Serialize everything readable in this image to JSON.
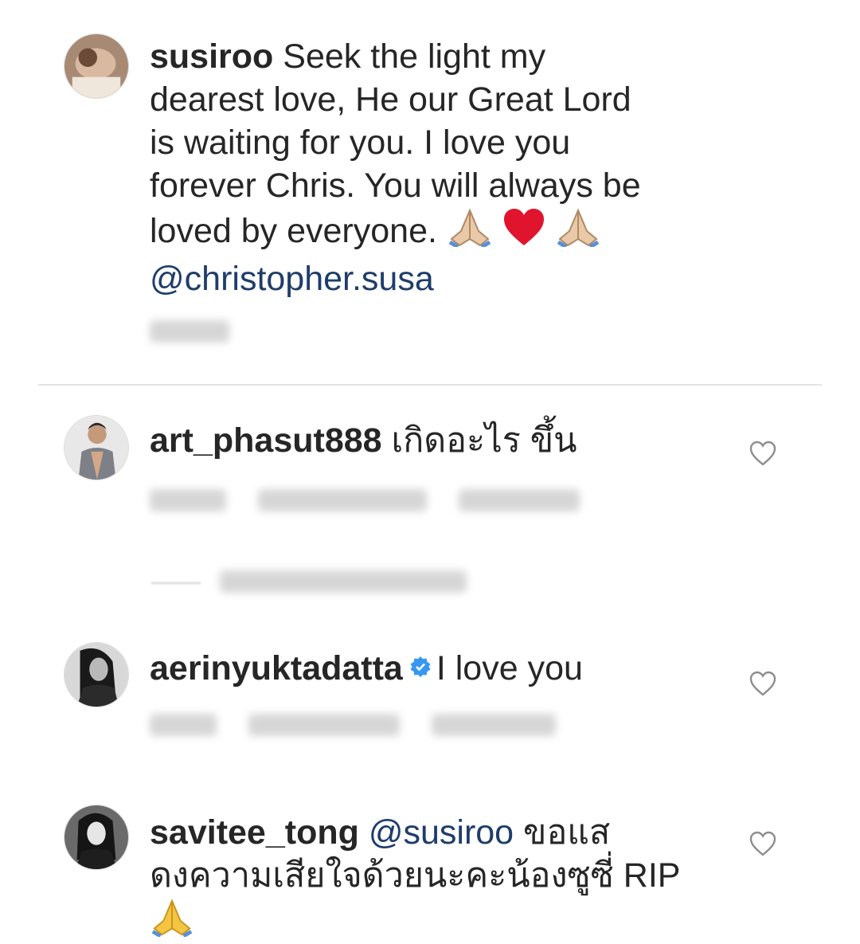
{
  "comments": [
    {
      "username": "susiroo",
      "text_line1": " Seek the light my",
      "text_line2": "dearest love, He our Great Lord",
      "text_line3": "is waiting for you. I love you",
      "text_line4": "forever Chris. You will always be",
      "text_line5": "loved by everyone.",
      "mention": "@christopher.susa",
      "emojis": [
        "folded-hands",
        "red-heart",
        "folded-hands"
      ]
    },
    {
      "username": "art_phasut888",
      "text": " เกิดอะไร ขึ้น"
    },
    {
      "username": "aerinyuktadatta",
      "verified": true,
      "text": "I love you"
    },
    {
      "username": "savitee_tong",
      "mention": "@susiroo",
      "text_line1": " ขอแส",
      "text_line2": "ดงความเสียใจด้วยนะคะน้องซูซี่ RIP",
      "emojis": [
        "folded-hands"
      ]
    }
  ],
  "colors": {
    "text": "#262626",
    "mention": "#1f3d6b",
    "verified": "#3897f0",
    "divider": "#e3e3e3",
    "heart_outline": "#8e8e8e"
  },
  "icons": {
    "like": "heart-outline-icon",
    "verified": "verified-badge-icon"
  }
}
